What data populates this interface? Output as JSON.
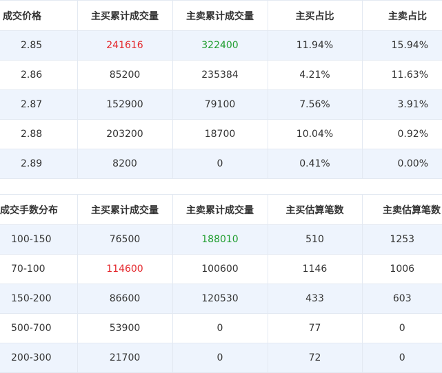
{
  "price_table": {
    "headers": [
      "成交价格",
      "主买累计成交量",
      "主卖累计成交量",
      "主买占比",
      "主卖占比"
    ],
    "rows": [
      {
        "price": "2.85",
        "buy_volume": "241616",
        "sell_volume": "322400",
        "buy_ratio": "11.94%",
        "sell_ratio": "15.94%"
      },
      {
        "price": "2.86",
        "buy_volume": "85200",
        "sell_volume": "235384",
        "buy_ratio": "4.21%",
        "sell_ratio": "11.63%"
      },
      {
        "price": "2.87",
        "buy_volume": "152900",
        "sell_volume": "79100",
        "buy_ratio": "7.56%",
        "sell_ratio": "3.91%"
      },
      {
        "price": "2.88",
        "buy_volume": "203200",
        "sell_volume": "18700",
        "buy_ratio": "10.04%",
        "sell_ratio": "0.92%"
      },
      {
        "price": "2.89",
        "buy_volume": "8200",
        "sell_volume": "0",
        "buy_ratio": "0.41%",
        "sell_ratio": "0.00%"
      }
    ]
  },
  "lot_table": {
    "headers": [
      "成交手数分布",
      "主买累计成交量",
      "主卖累计成交量",
      "主买估算笔数",
      "主卖估算笔数"
    ],
    "rows": [
      {
        "range": "100-150",
        "buy_volume": "76500",
        "sell_volume": "188010",
        "buy_count": "510",
        "sell_count": "1253"
      },
      {
        "range": "70-100",
        "buy_volume": "114600",
        "sell_volume": "100600",
        "buy_count": "1146",
        "sell_count": "1006"
      },
      {
        "range": "150-200",
        "buy_volume": "86600",
        "sell_volume": "120530",
        "buy_count": "433",
        "sell_count": "603"
      },
      {
        "range": "500-700",
        "buy_volume": "53900",
        "sell_volume": "0",
        "buy_count": "77",
        "sell_count": "0"
      },
      {
        "range": "200-300",
        "buy_volume": "21700",
        "sell_volume": "0",
        "buy_count": "72",
        "sell_count": "0"
      }
    ]
  },
  "colors": {
    "up": "#e4262b",
    "down": "#1f9d2f",
    "row_stripe": "#eef4fd",
    "border": "#e3e9f2"
  }
}
